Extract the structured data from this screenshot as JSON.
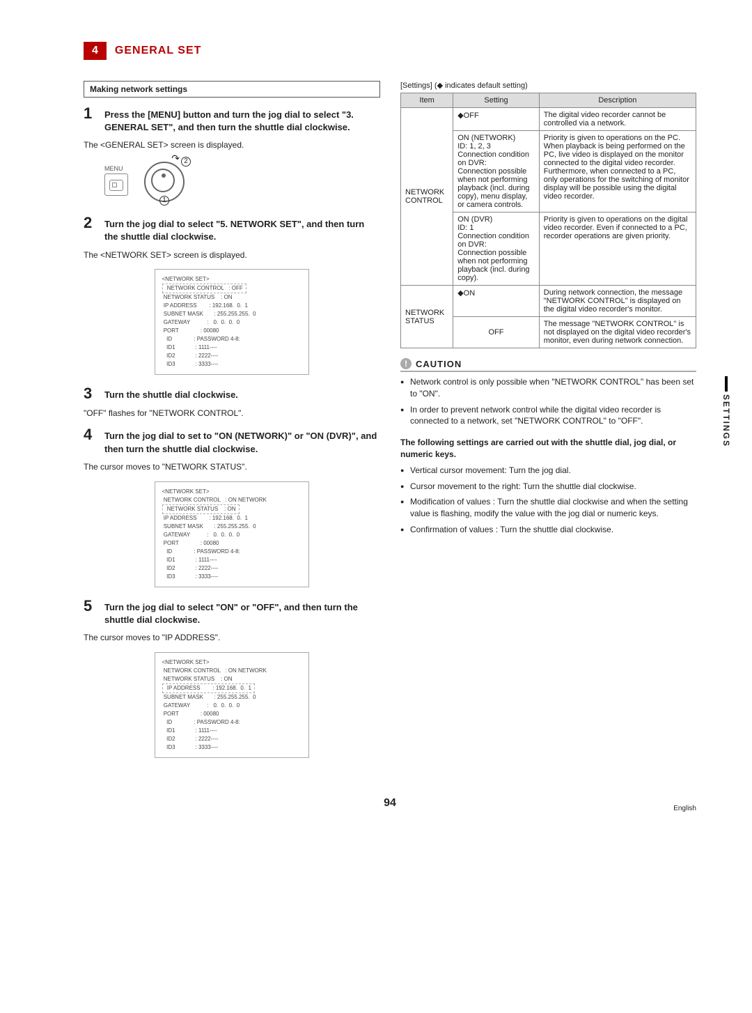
{
  "section": {
    "num": "4",
    "title": "GENERAL SET"
  },
  "left": {
    "box_title": "Making network settings",
    "step1": {
      "num": "1",
      "text": "Press the [MENU] button and turn the jog dial to select \"3. GENERAL SET\", and then turn the shuttle dial clockwise.",
      "after": "The <GENERAL SET> screen is displayed.",
      "menu_label": "MENU",
      "c1": "1",
      "c2": "2"
    },
    "step2": {
      "num": "2",
      "text": "Turn the jog dial to select \"5. NETWORK SET\", and then turn the shuttle dial clockwise.",
      "after": "The <NETWORK SET> screen is displayed."
    },
    "screen1": {
      "l1": "<NETWORK SET>",
      "l2": " NETWORK CONTROL   : OFF",
      "l3": " NETWORK STATUS    : ON",
      "l4": " IP ADDRESS        : 192.168.  0.  1",
      "l5": " SUBNET MASK       : 255.255.255.  0",
      "l6": " GATEWAY           :   0.  0.  0.  0",
      "l7": " PORT              : 00080",
      "l8": "   ID              : PASSWORD 4-8:",
      "l9": "   ID1             : 1111----",
      "l10": "   ID2             : 2222----",
      "l11": "   ID3             : 3333----"
    },
    "step3": {
      "num": "3",
      "text": "Turn the shuttle dial clockwise.",
      "after": "\"OFF\" flashes for \"NETWORK CONTROL\"."
    },
    "step4": {
      "num": "4",
      "text": "Turn the jog dial to set to \"ON (NETWORK)\" or \"ON (DVR)\", and then turn the shuttle dial clockwise.",
      "after": "The cursor moves to \"NETWORK STATUS\"."
    },
    "screen2_override_l2": " NETWORK CONTROL   : ON NETWORK",
    "step5": {
      "num": "5",
      "text": "Turn the jog dial to select \"ON\" or \"OFF\", and then turn the shuttle dial clockwise.",
      "after": "The cursor moves to \"IP ADDRESS\"."
    }
  },
  "right": {
    "settings_note": "[Settings] (◆ indicates default setting)",
    "headers": {
      "item": "Item",
      "setting": "Setting",
      "desc": "Description"
    },
    "nc_label": "NETWORK CONTROL",
    "ns_label": "NETWORK STATUS",
    "rows": {
      "nc_off": {
        "setting": "◆OFF",
        "desc": "The digital video recorder cannot be controlled via a network."
      },
      "nc_on_net": {
        "setting": "ON (NETWORK)\nID: 1, 2, 3\nConnection condition on DVR:\nConnection possible when not performing playback (incl. during copy), menu display, or camera controls.",
        "desc": "Priority is given to operations on the PC. When playback is being performed on the PC, live video is displayed on the monitor connected to the digital video recorder. Furthermore, when connected to a PC, only operations for the switching of monitor display will be possible using the digital video recorder."
      },
      "nc_on_dvr": {
        "setting": "ON (DVR)\nID: 1\nConnection condition on DVR:\nConnection possible when not performing playback (incl. during copy).",
        "desc": "Priority is given to operations on the digital video recorder. Even if connected to a PC, recorder operations are given priority."
      },
      "ns_on": {
        "setting": "◆ON",
        "desc": "During network connection, the message \"NETWORK CONTROL\" is displayed on the digital video recorder's monitor."
      },
      "ns_off": {
        "setting": "OFF",
        "desc": "The message \"NETWORK CONTROL\" is not displayed on the digital video recorder's monitor, even during network connection."
      }
    },
    "caution_label": "CAUTION",
    "caution_items": [
      "Network control is only possible when \"NETWORK CONTROL\" has been set to \"ON\".",
      "In order to prevent network control while the digital video recorder is connected to a network, set \"NETWORK CONTROL\" to \"OFF\"."
    ],
    "sub_heading": "The following settings are carried out with the shuttle dial, jog dial, or numeric keys.",
    "sub_items": [
      "Vertical cursor movement: Turn the jog dial.",
      "Cursor movement to the right: Turn the shuttle dial clockwise.",
      "Modification of values  : Turn the shuttle dial clockwise and when the setting value is flashing, modify the value with the jog dial or numeric keys.",
      "Confirmation of values : Turn the shuttle dial clockwise."
    ]
  },
  "side_tab": "SETTINGS",
  "page_num": "94",
  "lang": "English"
}
